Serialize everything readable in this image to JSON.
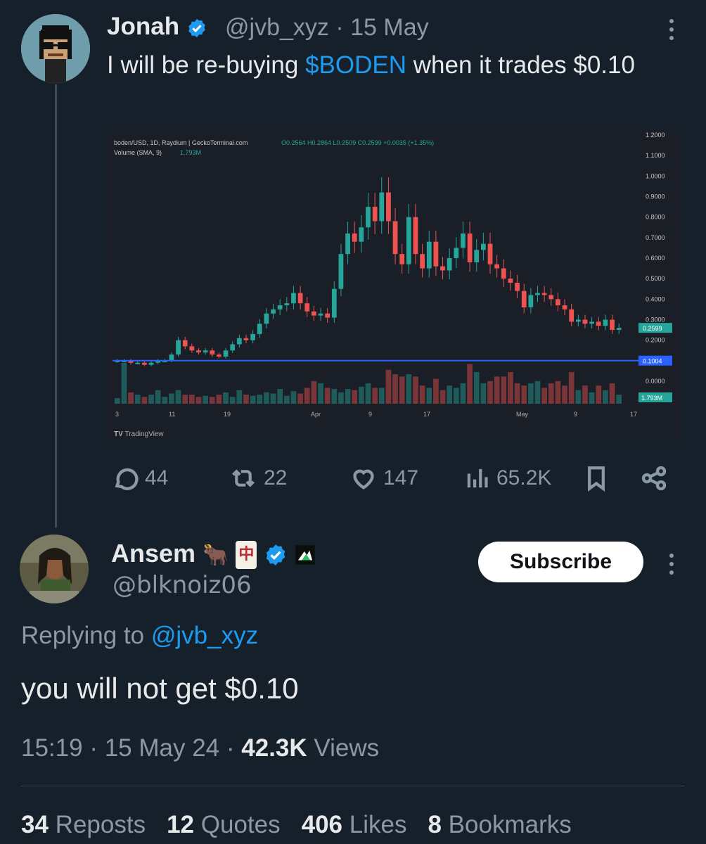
{
  "tweet": {
    "author_name": "Jonah",
    "author_handle": "@jvb_xyz",
    "separator": "·",
    "date": "15 May",
    "text_before": "I will be re-buying ",
    "cashtag": "$BODEN",
    "text_after": " when it trades $0.10",
    "actions": {
      "replies": "44",
      "reposts": "22",
      "likes": "147",
      "views": "65.2K"
    }
  },
  "chart_data": {
    "type": "candlestick",
    "header_line1": "boden/USD, 1D, Raydium | GeckoTerminal.com",
    "ohlc_text": "O0.2564 H0.2864 L0.2509 C0.2599 +0.0035 (+1.35%)",
    "header_line2": "Volume (SMA, 9)",
    "volume_value": "1.793M",
    "y_ticks": [
      "1.2000",
      "1.1000",
      "1.0000",
      "0.9000",
      "0.8000",
      "0.7000",
      "0.6000",
      "0.5000",
      "0.4000",
      "0.3000",
      "0.2000",
      "0.0000"
    ],
    "price_tag": "0.2599",
    "line_tag": "0.1004",
    "volume_tag": "1.793M",
    "x_ticks": [
      "3",
      "11",
      "19",
      "Apr",
      "9",
      "17",
      "May",
      "9",
      "17"
    ],
    "horizontal_line": 0.1004,
    "watermark": "TradingView",
    "closes": [
      0.1,
      0.1,
      0.09,
      0.09,
      0.08,
      0.09,
      0.1,
      0.1,
      0.13,
      0.2,
      0.17,
      0.15,
      0.14,
      0.15,
      0.13,
      0.12,
      0.15,
      0.18,
      0.21,
      0.2,
      0.23,
      0.28,
      0.33,
      0.35,
      0.37,
      0.38,
      0.43,
      0.38,
      0.34,
      0.32,
      0.33,
      0.31,
      0.45,
      0.62,
      0.72,
      0.68,
      0.75,
      0.85,
      0.78,
      0.92,
      0.78,
      0.62,
      0.57,
      0.8,
      0.62,
      0.55,
      0.68,
      0.56,
      0.54,
      0.6,
      0.65,
      0.72,
      0.58,
      0.64,
      0.67,
      0.57,
      0.55,
      0.5,
      0.48,
      0.44,
      0.36,
      0.42,
      0.43,
      0.42,
      0.4,
      0.37,
      0.35,
      0.29,
      0.3,
      0.28,
      0.29,
      0.27,
      0.3,
      0.25,
      0.26
    ],
    "volumes": [
      5,
      36,
      10,
      8,
      6,
      8,
      12,
      6,
      9,
      12,
      8,
      8,
      6,
      7,
      6,
      8,
      10,
      6,
      12,
      8,
      7,
      8,
      10,
      9,
      13,
      7,
      11,
      9,
      14,
      20,
      18,
      14,
      13,
      10,
      13,
      12,
      15,
      18,
      14,
      14,
      30,
      26,
      24,
      26,
      24,
      16,
      14,
      22,
      12,
      16,
      14,
      18,
      35,
      28,
      18,
      20,
      24,
      24,
      28,
      18,
      16,
      18,
      20,
      14,
      18,
      20,
      16,
      28,
      12,
      16,
      10,
      16,
      12,
      18,
      8
    ]
  },
  "reply": {
    "author_name": "Ansem",
    "author_handle": "@blknoiz06",
    "badge_emoji_1": "🐂",
    "badge_emoji_2": "🀄",
    "subscribe_label": "Subscribe",
    "replying_label": "Replying to",
    "replying_mention": "@jvb_xyz",
    "text": "you will not get $0.10",
    "time": "15:19",
    "separator": "·",
    "date": "15 May 24",
    "views_count": "42.3K",
    "views_label": "Views"
  },
  "stats": {
    "reposts_count": "34",
    "reposts_label": "Reposts",
    "quotes_count": "12",
    "quotes_label": "Quotes",
    "likes_count": "406",
    "likes_label": "Likes",
    "bookmarks_count": "8",
    "bookmarks_label": "Bookmarks"
  },
  "colors": {
    "background": "#15202b",
    "accent": "#1d9bf0",
    "up_candle": "#26a69a",
    "down_candle": "#ef5350"
  }
}
